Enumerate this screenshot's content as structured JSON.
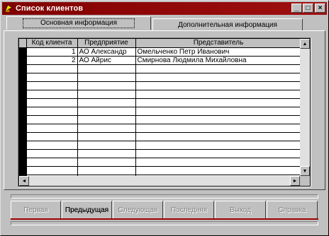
{
  "window": {
    "title": "Список клиентов",
    "controls": {
      "minimize": "_",
      "maximize": "□",
      "close": "×"
    }
  },
  "tabs": [
    {
      "label": "Основная информация",
      "active": true
    },
    {
      "label": "Дополнительная информация",
      "active": false
    }
  ],
  "grid": {
    "columns": [
      "Код клиента",
      "Предприятие",
      "Представитель"
    ],
    "rows": [
      {
        "code": "1",
        "company": "АО Александр",
        "representative": "Омельченко Петр Иванович"
      },
      {
        "code": "2",
        "company": "АО Айрис",
        "representative": "Смирнова Людмила Михайловна"
      }
    ],
    "scroll": {
      "up": "▲",
      "down": "▼",
      "left": "◄",
      "right": "►"
    }
  },
  "buttons": [
    {
      "label": "Первая",
      "disabled": true
    },
    {
      "label": "Предыдущая",
      "disabled": false
    },
    {
      "label": "Следующая",
      "disabled": true
    },
    {
      "label": "Последняя",
      "disabled": true
    },
    {
      "label": "Выход",
      "disabled": true
    },
    {
      "label": "Справка",
      "disabled": true
    }
  ],
  "colors": {
    "titlebar": "#800000",
    "accent": "#a00000",
    "face": "#c0c0c0"
  }
}
